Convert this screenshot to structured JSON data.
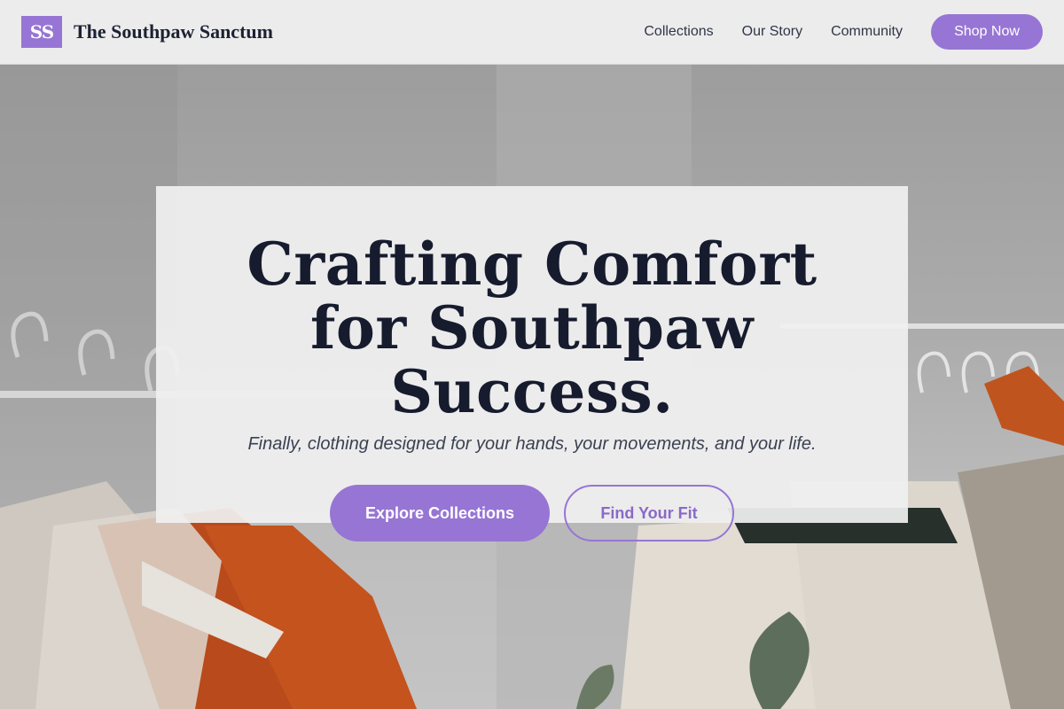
{
  "header": {
    "logo_text": "SS",
    "brand_name": "The Southpaw Sanctum",
    "nav": [
      "Collections",
      "Our Story",
      "Community"
    ],
    "cta_label": "Shop Now"
  },
  "hero": {
    "title": "Crafting Comfort for Southpaw Success.",
    "subtitle": "Finally, clothing designed for your hands, your movements, and your life.",
    "primary_label": "Explore Collections",
    "secondary_label": "Find Your Fit"
  },
  "colors": {
    "accent": "#9775d4",
    "heading": "#161b2e",
    "header_bg": "#ececec"
  }
}
